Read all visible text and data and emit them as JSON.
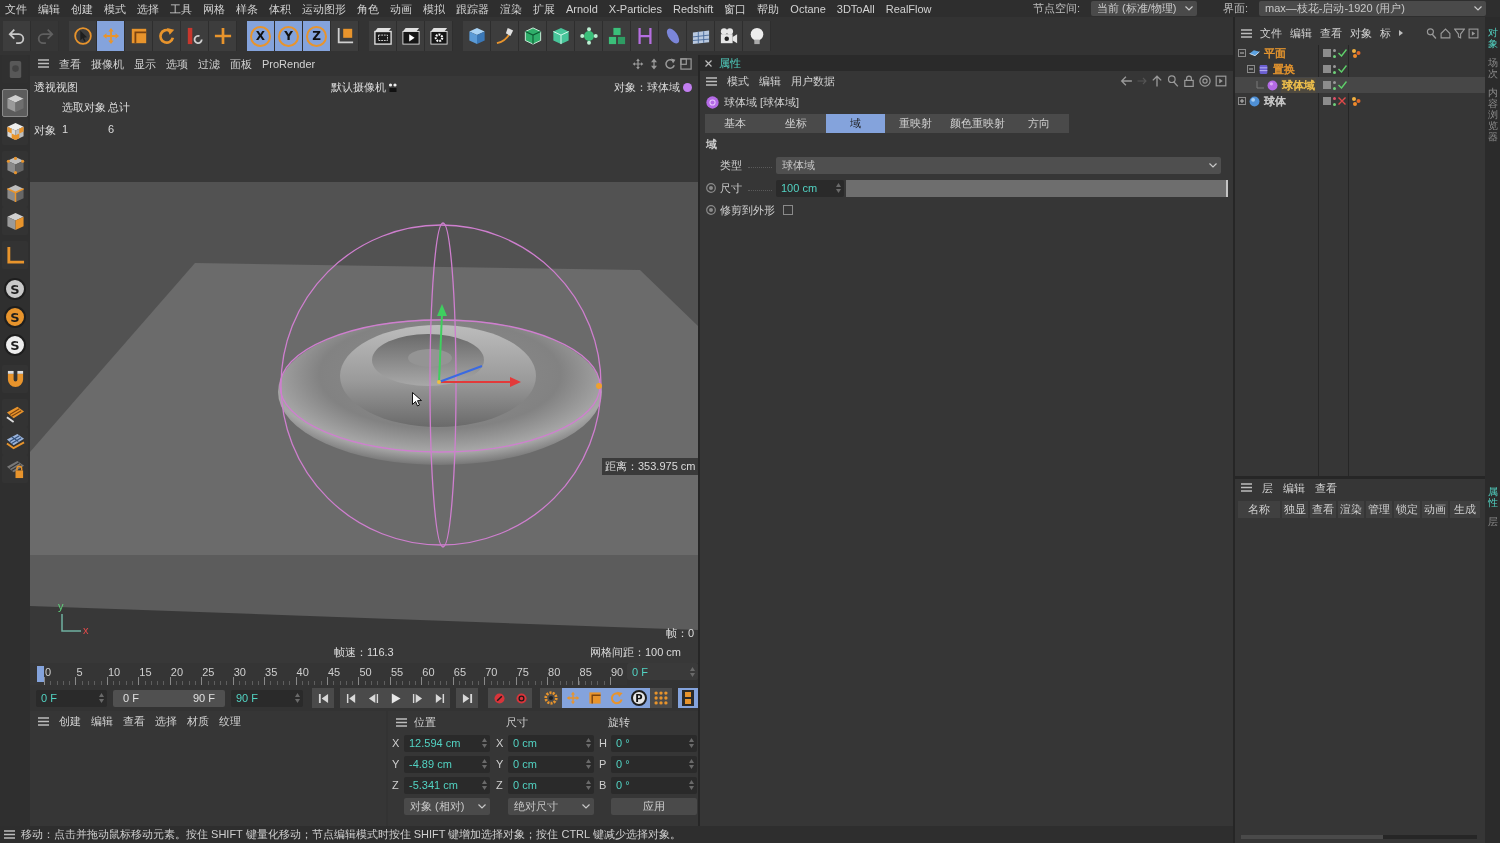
{
  "menu_bar": {
    "items": [
      "文件",
      "编辑",
      "创建",
      "模式",
      "选择",
      "工具",
      "网格",
      "样条",
      "体积",
      "运动图形",
      "角色",
      "动画",
      "模拟",
      "跟踪器",
      "渲染",
      "扩展",
      "Arnold",
      "X-Particles",
      "Redshift",
      "窗口",
      "帮助",
      "Octane",
      "3DToAll",
      "RealFlow"
    ],
    "node_space": {
      "label": "节点空间:",
      "value": "当前 (标准/物理)"
    },
    "layout": {
      "label": "界面:",
      "value": "max—枝花-启动-1920 (用户)"
    }
  },
  "toolbar": {
    "groups": [
      [
        {
          "kind": "undo",
          "on": false,
          "disabled": false
        },
        {
          "kind": "redo",
          "on": false,
          "disabled": true
        }
      ],
      [
        {
          "kind": "live-select",
          "on": false,
          "disabled": false
        },
        {
          "kind": "move",
          "on": true,
          "disabled": false
        },
        {
          "kind": "scale",
          "on": false,
          "disabled": false
        },
        {
          "kind": "rotate",
          "on": false,
          "disabled": false
        },
        {
          "kind": "psr",
          "on": false,
          "disabled": false
        },
        {
          "kind": "world-axis",
          "on": false,
          "disabled": false
        }
      ],
      [
        {
          "kind": "axis",
          "label": "X",
          "on": true,
          "disabled": false
        },
        {
          "kind": "axis",
          "label": "Y",
          "on": true,
          "disabled": false
        },
        {
          "kind": "axis",
          "label": "Z",
          "on": true,
          "disabled": false
        },
        {
          "kind": "coord-system",
          "on": false,
          "disabled": false
        }
      ],
      [
        {
          "kind": "render-region",
          "on": false,
          "disabled": false
        },
        {
          "kind": "render-view",
          "on": false,
          "disabled": false
        },
        {
          "kind": "render-settings",
          "on": false,
          "disabled": false
        }
      ],
      [
        {
          "kind": "cube",
          "on": false,
          "disabled": false
        },
        {
          "kind": "pen",
          "on": false,
          "disabled": false
        },
        {
          "kind": "subdivision",
          "on": false,
          "disabled": false
        },
        {
          "kind": "extrude",
          "on": false,
          "disabled": false
        },
        {
          "kind": "cloner",
          "on": false,
          "disabled": false
        },
        {
          "kind": "mograph",
          "on": false,
          "disabled": false
        },
        {
          "kind": "deformer",
          "on": false,
          "disabled": false
        },
        {
          "kind": "field",
          "on": false,
          "disabled": false
        },
        {
          "kind": "floor",
          "on": false,
          "disabled": false
        },
        {
          "kind": "camera",
          "on": false,
          "disabled": false
        },
        {
          "kind": "light",
          "on": false,
          "disabled": false
        }
      ]
    ]
  },
  "palette": {
    "groups": [
      [
        {
          "kind": "convert",
          "selected": false,
          "disabled": true
        }
      ],
      [
        {
          "kind": "model",
          "selected": true,
          "disabled": false
        },
        {
          "kind": "texture",
          "selected": false,
          "disabled": false
        }
      ],
      [
        {
          "kind": "points",
          "selected": false,
          "disabled": false
        },
        {
          "kind": "edges",
          "selected": false,
          "disabled": false
        },
        {
          "kind": "polygons",
          "selected": false,
          "disabled": false
        }
      ],
      [
        {
          "kind": "axis-mode",
          "selected": false,
          "disabled": false
        }
      ],
      [
        {
          "kind": "badge",
          "label": "S",
          "color": "#c9c9c9",
          "selected": false,
          "disabled": false
        },
        {
          "kind": "badge",
          "label": "S",
          "color": "#e8942c",
          "selected": false,
          "disabled": false
        },
        {
          "kind": "badge",
          "label": "S",
          "color": "#eeeeee",
          "selected": false,
          "disabled": false
        }
      ],
      [
        {
          "kind": "magnet",
          "selected": false,
          "disabled": false
        }
      ],
      [
        {
          "kind": "workplane",
          "selected": false,
          "disabled": false
        },
        {
          "kind": "workplane-grid",
          "selected": false,
          "disabled": false
        },
        {
          "kind": "workplane-lock",
          "selected": false,
          "disabled": false
        }
      ]
    ]
  },
  "viewport": {
    "menu": [
      "查看",
      "摄像机",
      "显示",
      "选项",
      "过滤",
      "面板",
      "ProRender"
    ],
    "view_name": "透视视图",
    "camera": "默认摄像机",
    "active_object": "对象：球体域",
    "hud": {
      "headers": [
        "选取对象",
        "总计"
      ],
      "row_label": "对象",
      "values": [
        "1",
        "6"
      ]
    },
    "distance": "距离：353.975 cm",
    "frame": "帧：0",
    "fps": "帧速：116.3",
    "grid_spacing": "网格间距：100 cm",
    "axis_labels": [
      "y",
      "x"
    ]
  },
  "timeline": {
    "ticks": [
      "0",
      "5",
      "10",
      "15",
      "20",
      "25",
      "30",
      "35",
      "40",
      "45",
      "50",
      "55",
      "60",
      "65",
      "70",
      "75",
      "80",
      "85",
      "90"
    ],
    "level": 0,
    "current": "0 F",
    "start": "0 F",
    "range_start": "0 F",
    "range_end": "90 F",
    "end": "90 F",
    "transport": [
      [
        {
          "kind": "first"
        }
      ],
      [
        {
          "kind": "prev-key"
        },
        {
          "kind": "prev-frame"
        },
        {
          "kind": "play"
        },
        {
          "kind": "next-frame"
        },
        {
          "kind": "next-key"
        }
      ],
      [
        {
          "kind": "last"
        }
      ],
      [
        {
          "kind": "record"
        },
        {
          "kind": "auto-key"
        }
      ]
    ],
    "key_filters": [
      {
        "kind": "gear",
        "on": false
      },
      {
        "kind": "move",
        "on": true
      },
      {
        "kind": "scale",
        "on": true
      },
      {
        "kind": "rotate",
        "on": true
      },
      {
        "kind": "param",
        "label": "P",
        "on": true
      },
      {
        "kind": "points",
        "on": false
      }
    ],
    "dopesheet_button": {
      "on": true
    }
  },
  "materials": {
    "menu": [
      "创建",
      "编辑",
      "查看",
      "选择",
      "材质",
      "纹理"
    ]
  },
  "coordinates": {
    "headers": [
      "位置",
      "尺寸",
      "旋转"
    ],
    "rows": [
      [
        {
          "axis": "X",
          "value": "12.594 cm"
        },
        {
          "axis": "X",
          "value": "0 cm"
        },
        {
          "axis": "H",
          "value": "0 °"
        }
      ],
      [
        {
          "axis": "Y",
          "value": "-4.89 cm"
        },
        {
          "axis": "Y",
          "value": "0 cm"
        },
        {
          "axis": "P",
          "value": "0 °"
        }
      ],
      [
        {
          "axis": "Z",
          "value": "-5.341 cm"
        },
        {
          "axis": "Z",
          "value": "0 cm"
        },
        {
          "axis": "B",
          "value": "0 °"
        }
      ]
    ],
    "mode": "对象 (相对)",
    "size_mode": "绝对尺寸",
    "apply": "应用"
  },
  "attributes": {
    "title": "属性",
    "menu": [
      "模式",
      "编辑",
      "用户数据"
    ],
    "object": "球体域 [球体域]",
    "tabs": [
      {
        "label": "基本",
        "selected": false
      },
      {
        "label": "坐标",
        "selected": false
      },
      {
        "label": "域",
        "selected": true
      },
      {
        "label": "重映射",
        "selected": false
      },
      {
        "label": "颜色重映射",
        "selected": false
      },
      {
        "label": "方向",
        "selected": false
      }
    ],
    "section": "域",
    "params": [
      {
        "kind": "dropdown",
        "label": "类型",
        "value": "球体域",
        "animatable": false
      },
      {
        "kind": "slider",
        "label": "尺寸",
        "value": "100 cm",
        "level": 1,
        "animatable": true
      },
      {
        "kind": "checkbox",
        "label": "修剪到外形",
        "checked": false,
        "animatable": true
      }
    ]
  },
  "object_manager": {
    "menu": [
      "文件",
      "编辑",
      "查看",
      "对象",
      "标"
    ],
    "objects": [
      {
        "name": "平面",
        "kind": "plane",
        "color": "#e0922e",
        "selected": false,
        "expanded": true,
        "enabled": true,
        "editor_visible": true,
        "tag": true,
        "children": [
          {
            "name": "置换",
            "kind": "displacer",
            "color": "#e0922e",
            "selected": false,
            "expanded": true,
            "enabled": true,
            "editor_visible": true,
            "tag": false,
            "children": [
              {
                "name": "球体域",
                "kind": "sphere-field",
                "color": "#f2c24c",
                "selected": true,
                "enabled": true,
                "editor_visible": true,
                "tag": false
              }
            ]
          }
        ]
      },
      {
        "name": "球体",
        "kind": "sphere",
        "color": "#cfcfcf",
        "selected": false,
        "expanded": false,
        "enabled": false,
        "editor_visible": false,
        "tag": true
      }
    ]
  },
  "layer_manager": {
    "menu": [
      "层",
      "编辑",
      "查看"
    ],
    "columns": [
      "名称",
      "独显",
      "查看",
      "渲染",
      "管理",
      "锁定",
      "动画",
      "生成"
    ]
  },
  "side_tabs": {
    "top": [
      {
        "label": "对象",
        "selected": true
      },
      {
        "label": "场次",
        "selected": false
      },
      {
        "label": "内容浏览器",
        "selected": false
      }
    ],
    "bottom": [
      {
        "label": "属性",
        "selected": true
      },
      {
        "label": "层",
        "selected": false
      }
    ]
  },
  "status_bar": {
    "text": "移动：点击并拖动鼠标移动元素。按住 SHIFT 键量化移动；节点编辑模式时按住 SHIFT 键增加选择对象；按住 CTRL 键减少选择对象。"
  }
}
